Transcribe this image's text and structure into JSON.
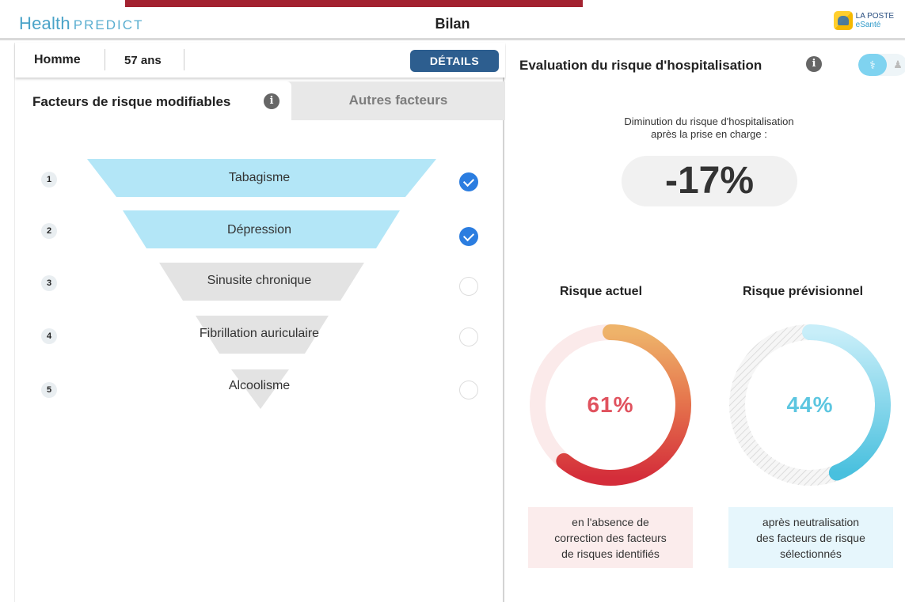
{
  "header": {
    "brand_main": "Health",
    "brand_sub": "PREDICT",
    "title": "Bilan",
    "partner_line1": "LA POSTE",
    "partner_line2": "eSanté"
  },
  "patient": {
    "sex": "Homme",
    "age": "57 ans",
    "details_label": "DÉTAILS"
  },
  "tabs": {
    "active": "Facteurs de risque modifiables",
    "other": "Autres facteurs"
  },
  "risk_factors": [
    {
      "rank": "1",
      "label": "Tabagisme",
      "selected": true
    },
    {
      "rank": "2",
      "label": "Dépression",
      "selected": true
    },
    {
      "rank": "3",
      "label": "Sinusite chronique",
      "selected": false
    },
    {
      "rank": "4",
      "label": "Fibrillation auriculaire",
      "selected": false
    },
    {
      "rank": "5",
      "label": "Alcoolisme",
      "selected": false
    }
  ],
  "evaluation": {
    "title": "Evaluation du risque d'hospitalisation",
    "reduction_label_line1": "Diminution du risque d'hospitalisation",
    "reduction_label_line2": "après la prise en charge :",
    "reduction_value": "-17%",
    "current": {
      "heading": "Risque actuel",
      "value_text": "61%",
      "fraction": 0.61,
      "caption_line1": "en l'absence de",
      "caption_line2": "correction des facteurs",
      "caption_line3": "de risques identifiés"
    },
    "forecast": {
      "heading": "Risque prévisionnel",
      "value_text": "44%",
      "fraction": 0.44,
      "caption_line1": "après neutralisation",
      "caption_line2": "des facteurs de risque",
      "caption_line3": "sélectionnés"
    }
  },
  "colors": {
    "brand_red": "#a32230",
    "band_selected": "#b3e6f7",
    "band_unselected": "#e3e3e3",
    "check_blue": "#2b7de0",
    "current_risk": "#e0525e",
    "forecast_risk": "#5cc6e0",
    "details_button": "#2d5e8f"
  },
  "icons": {
    "info": "info-icon",
    "check": "check-icon",
    "toggle_left": "stethoscope-icon",
    "toggle_right": "person-icon"
  }
}
